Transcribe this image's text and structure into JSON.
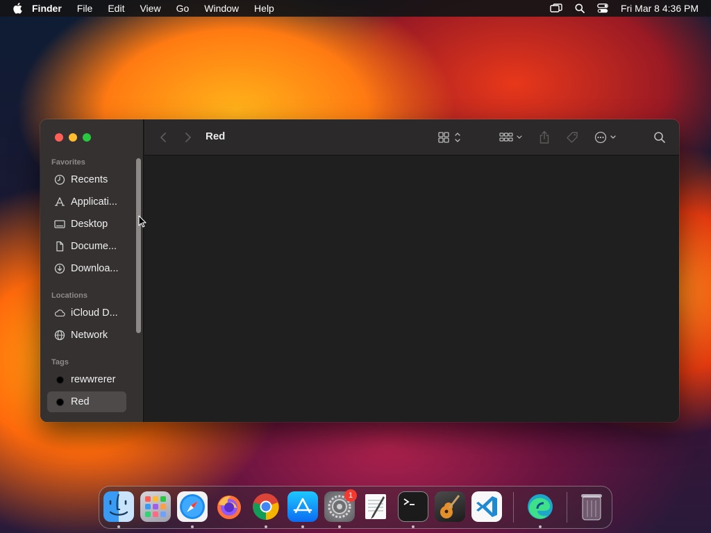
{
  "menubar": {
    "app_name": "Finder",
    "items": [
      "File",
      "Edit",
      "View",
      "Go",
      "Window",
      "Help"
    ],
    "clock": "Fri Mar 8  4:36 PM",
    "status_icons": [
      "screen-mirroring-icon",
      "spotlight-search-icon",
      "control-center-icon"
    ]
  },
  "window": {
    "title": "Red",
    "sidebar": {
      "favorites_header": "Favorites",
      "favorites": [
        {
          "label": "Recents",
          "icon": "clock-icon"
        },
        {
          "label": "Applicati...",
          "icon": "applications-icon"
        },
        {
          "label": "Desktop",
          "icon": "desktop-icon"
        },
        {
          "label": "Docume...",
          "icon": "document-icon"
        },
        {
          "label": "Downloa...",
          "icon": "download-icon"
        }
      ],
      "locations_header": "Locations",
      "locations": [
        {
          "label": "iCloud D...",
          "icon": "cloud-icon"
        },
        {
          "label": "Network",
          "icon": "globe-icon"
        }
      ],
      "tags_header": "Tags",
      "tags": [
        {
          "label": "rewwrerer",
          "color": "#000000"
        },
        {
          "label": "Red",
          "color": "#000000",
          "selected": true
        }
      ]
    },
    "toolbar_icons": [
      "back-icon",
      "forward-icon",
      "view-grid-icon",
      "group-icon",
      "share-icon",
      "tag-icon",
      "more-actions-icon",
      "search-icon"
    ]
  },
  "dock": {
    "apps": [
      "Finder",
      "Launchpad",
      "Safari",
      "Firefox",
      "Google Chrome",
      "App Store",
      "System Settings",
      "TextEdit",
      "Terminal",
      "GarageBand",
      "Visual Studio Code",
      "Microsoft Edge",
      "Trash"
    ],
    "system_settings_badge": "1"
  },
  "colors": {
    "close": "#ff5f57",
    "minimize": "#febc2e",
    "zoom": "#28c840",
    "sidebar_bg": "#353131",
    "selected_row": "#4d4a49"
  }
}
